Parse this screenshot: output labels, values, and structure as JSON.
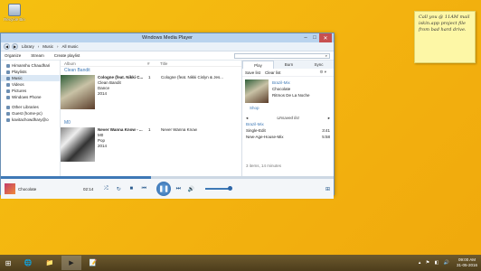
{
  "desktop": {
    "recycle_label": "Recycle Bin"
  },
  "sticky_note": {
    "text": "Call you @ 11AM mail iskin.app project file from bad hard drive."
  },
  "window": {
    "title": "Windows Media Player",
    "breadcrumb": [
      "Library",
      "Music",
      "All music"
    ],
    "toolbar": [
      "Organize",
      "Stream",
      "Create playlist"
    ],
    "search_placeholder": ""
  },
  "nav": {
    "user": "Himanshu Chaudhari",
    "items": [
      "Playlists",
      "Music",
      "Videos",
      "Pictures",
      "Windows Phone"
    ],
    "other_header": "Other Libraries",
    "other_items": [
      "Guest (home-pc)",
      "kavitachowdhary@o"
    ]
  },
  "library": {
    "col_album": "Album",
    "col_num": "#",
    "col_title": "Title",
    "groups": [
      {
        "artist": "Clean Bandit",
        "album": "Cologne (feat. Nikki C...",
        "album_artist": "Clean Bandit",
        "genre": "Dance",
        "year": "2014",
        "num": "1",
        "track": "Cologne (feat. Nikki Cislyn & Jes..."
      },
      {
        "artist": "M0",
        "album": "Never Wanna Know - ...",
        "album_artist": "M0",
        "genre": "Pop",
        "year": "2014",
        "num": "1",
        "track": "Never Wanna Know"
      }
    ]
  },
  "panel": {
    "tabs": [
      "Play",
      "Burn",
      "Sync"
    ],
    "save_list": "Save list",
    "clear_list": "Clear list",
    "now_playing": {
      "artist": "Brazil-Mix",
      "track": "Chocolate",
      "album": "Ritmos De La Noche"
    },
    "shop": "Shop",
    "unsaved": "Unsaved list",
    "playlist": [
      {
        "title": "Brazil-Mix",
        "time": ""
      },
      {
        "title": "Single-Edit",
        "time": "3:41"
      },
      {
        "title": "New-Age-House-Mix",
        "time": "5:58"
      }
    ],
    "footer": "3 items, 14 minutes"
  },
  "player": {
    "current_track": "Chocolate",
    "elapsed": "02:14",
    "progress": 0.45,
    "volume": 0.7
  },
  "taskbar": {
    "time": "09:00 AM",
    "date": "31-05-2016"
  },
  "colors": {
    "accent": "#3e79b6",
    "desktop": "#f3b20f"
  }
}
